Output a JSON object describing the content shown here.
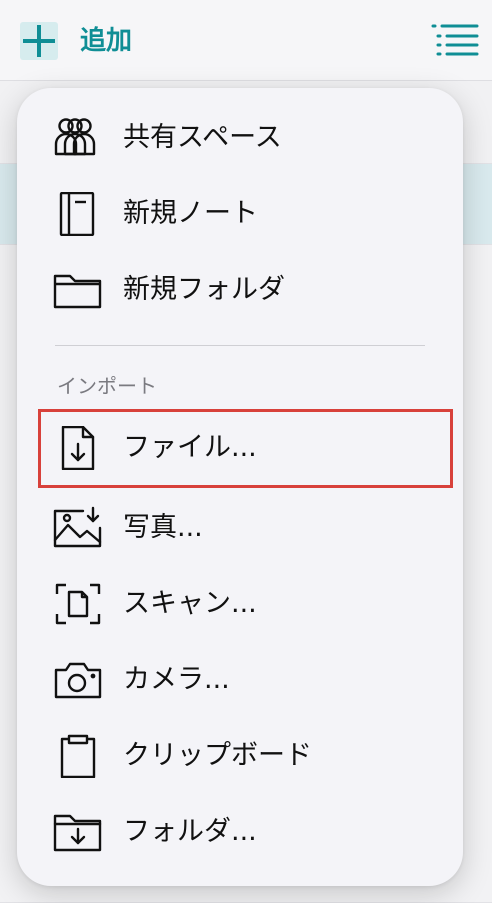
{
  "topbar": {
    "add_label": "追加",
    "accent_color": "#0f8e95"
  },
  "menu": {
    "items": [
      {
        "label": "共有スペース",
        "icon": "people-group-icon"
      },
      {
        "label": "新規ノート",
        "icon": "notebook-icon"
      },
      {
        "label": "新規フォルダ",
        "icon": "folder-icon"
      }
    ],
    "import_section": {
      "title": "インポート",
      "items": [
        {
          "label": "ファイル...",
          "icon": "file-import-icon",
          "highlighted": true,
          "highlight_color": "#d8413b"
        },
        {
          "label": "写真...",
          "icon": "photo-import-icon"
        },
        {
          "label": "スキャン...",
          "icon": "scan-document-icon"
        },
        {
          "label": "カメラ...",
          "icon": "camera-icon"
        },
        {
          "label": "クリップボード",
          "icon": "clipboard-icon"
        },
        {
          "label": "フォルダ...",
          "icon": "folder-import-icon"
        }
      ]
    }
  }
}
